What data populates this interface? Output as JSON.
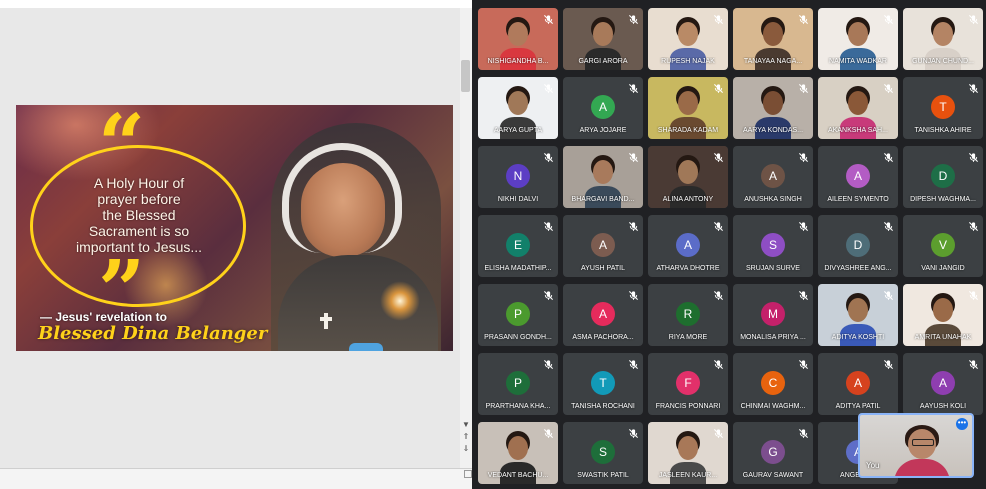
{
  "slide": {
    "quote_open": "“",
    "quote_close": "”",
    "quote_lines": [
      "A Holy Hour of",
      "prayer before",
      "the Blessed",
      "Sacrament is so",
      "important to Jesus..."
    ],
    "revelation": "— Jesus' revelation to",
    "name": "Blessed Dina Belanger",
    "accent_color": "#ffd21a"
  },
  "self_view": {
    "label": "You"
  },
  "participants": [
    {
      "name": "NISHIGANDHA B...",
      "video": true,
      "bg": "#c86a5a",
      "skin": "#b07a5c",
      "shirt": "#d9383f"
    },
    {
      "name": "GARGI ARORA",
      "video": true,
      "bg": "#6a5a50",
      "skin": "#a87a5a",
      "shirt": "#2a2a2a"
    },
    {
      "name": "RUPESH NAJAK",
      "video": true,
      "bg": "#e8ddd0",
      "skin": "#b98a66",
      "shirt": "#5a6aa8"
    },
    {
      "name": "TANAYAA NAGA...",
      "video": true,
      "bg": "#d8b890",
      "skin": "#8a5a3c",
      "shirt": "#4a3a30"
    },
    {
      "name": "NAMITA WADKAR",
      "video": true,
      "bg": "#f0ebe6",
      "skin": "#a87858",
      "shirt": "#3a6a9a"
    },
    {
      "name": "GUNJAN CHUND...",
      "video": true,
      "bg": "#e8e2da",
      "skin": "#b48464",
      "shirt": "#d8d0c8"
    },
    {
      "name": "AARYA GUPTA",
      "video": true,
      "bg": "#eef0f2",
      "skin": "#a07858",
      "shirt": "#3a3a3a"
    },
    {
      "name": "ARYA JOJARE",
      "letter": "A",
      "color": "#33a852"
    },
    {
      "name": "SHARADA KADAM",
      "video": true,
      "bg": "#c8b860",
      "skin": "#9a6a48",
      "shirt": "#6a4a30"
    },
    {
      "name": "AARYA KONDAS...",
      "video": true,
      "bg": "#b8b0a8",
      "skin": "#7a4e34",
      "shirt": "#2a3a6a"
    },
    {
      "name": "AKANKSHA SAH...",
      "video": true,
      "bg": "#d8d0c4",
      "skin": "#8a5838",
      "shirt": "#c83a7a"
    },
    {
      "name": "TANISHKA AHIRE",
      "letter": "T",
      "color": "#e8510e"
    },
    {
      "name": "NIKHI DALVI",
      "letter": "N",
      "color": "#5c3ec4"
    },
    {
      "name": "BHARGAVI BAND...",
      "video": true,
      "bg": "#a8a098",
      "skin": "#a87a5c",
      "shirt": "#3a4a5a"
    },
    {
      "name": "ALINA ANTONY",
      "video": true,
      "bg": "#4a3a34",
      "skin": "#a07858",
      "shirt": "#2a2a2a"
    },
    {
      "name": "ANUSHKA SINGH",
      "letter": "A",
      "color": "#6e5346"
    },
    {
      "name": "AILEEN SYMENTO",
      "letter": "A",
      "color": "#b35cc4"
    },
    {
      "name": "DIPESH WAGHMA...",
      "letter": "D",
      "color": "#1e6e47"
    },
    {
      "name": "ELISHA MADATHIP...",
      "letter": "E",
      "color": "#12806a"
    },
    {
      "name": "AYUSH PATIL",
      "letter": "A",
      "color": "#7c5c50"
    },
    {
      "name": "ATHARVA DHOTRE",
      "letter": "A",
      "color": "#5b6cc8"
    },
    {
      "name": "SRUJAN SURVE",
      "letter": "S",
      "color": "#8e4ec4"
    },
    {
      "name": "DIVYASHREE ANG...",
      "letter": "D",
      "color": "#4e6d78"
    },
    {
      "name": "VANI JANGID",
      "letter": "V",
      "color": "#5c9e2e"
    },
    {
      "name": "PRASANN GONDH...",
      "letter": "P",
      "color": "#4b9a2e"
    },
    {
      "name": "ASMA PACHORA...",
      "letter": "A",
      "color": "#e52b5c"
    },
    {
      "name": "RIYA MORE",
      "letter": "R",
      "color": "#1e6e2e"
    },
    {
      "name": "MONALISA PRIYA ...",
      "letter": "M",
      "color": "#c4216a"
    },
    {
      "name": "ADITYA KOSHTI",
      "video": true,
      "bg": "#c8d0d8",
      "skin": "#a07452",
      "shirt": "#3a5ab8"
    },
    {
      "name": "AMRITA UNAHAK",
      "video": true,
      "bg": "#f0e8e0",
      "skin": "#9a6a48",
      "shirt": "#5a4a3a"
    },
    {
      "name": "PRARTHANA KHA...",
      "letter": "P",
      "color": "#1e6e3a"
    },
    {
      "name": "TANISHA ROCHANI",
      "letter": "T",
      "color": "#129ab8"
    },
    {
      "name": "FRANCIS PONNARI",
      "letter": "F",
      "color": "#e2306a"
    },
    {
      "name": "CHINMAI WAGHM...",
      "letter": "C",
      "color": "#e8630e"
    },
    {
      "name": "ADITYA PATIL",
      "letter": "A",
      "color": "#d6421e"
    },
    {
      "name": "AAYUSH KOLI",
      "letter": "A",
      "color": "#8e3eb0"
    },
    {
      "name": "VEDANT BACHU...",
      "video": true,
      "bg": "#c8c0b8",
      "skin": "#a07050",
      "shirt": "#2a2a2a"
    },
    {
      "name": "SWASTIK PATIL",
      "letter": "S",
      "color": "#1e6e3a"
    },
    {
      "name": "JASLEEN KAUR...",
      "video": true,
      "bg": "#e0d8d0",
      "skin": "#a87858",
      "shirt": "#4a4a4a"
    },
    {
      "name": "GAURAV SAWANT",
      "letter": "G",
      "color": "#7c4e8e"
    },
    {
      "name": "ANGEL K...",
      "letter": "A",
      "color": "#5e6ec8"
    }
  ]
}
